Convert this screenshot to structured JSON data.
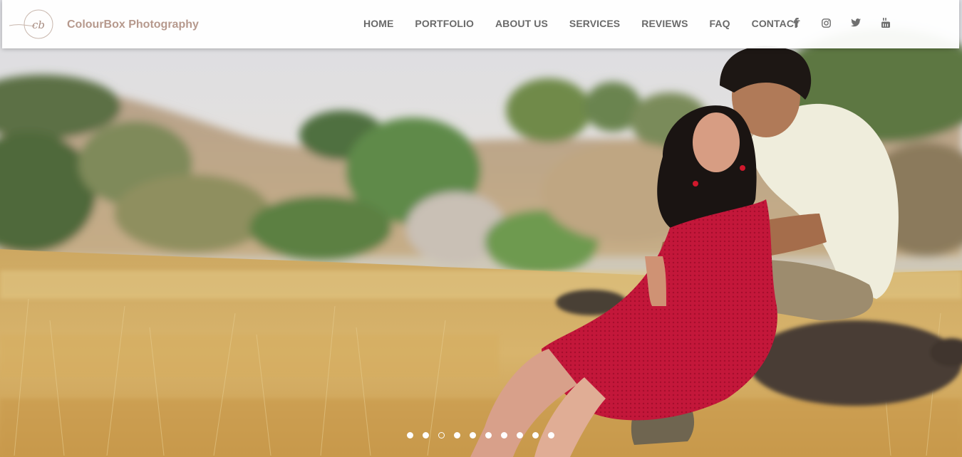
{
  "brand": {
    "name": "ColourBox Photography",
    "logo_icon": "cb-monogram-logo",
    "color": "#b6998d"
  },
  "nav": {
    "items": [
      {
        "label": "HOME"
      },
      {
        "label": "PORTFOLIO"
      },
      {
        "label": "ABOUT US"
      },
      {
        "label": "SERVICES"
      },
      {
        "label": "REVIEWS"
      },
      {
        "label": "FAQ"
      },
      {
        "label": "CONTACT"
      }
    ],
    "text_color": "#6a6a6a"
  },
  "socials": [
    {
      "icon": "facebook-icon"
    },
    {
      "icon": "instagram-icon"
    },
    {
      "icon": "twitter-icon"
    },
    {
      "icon": "youtube-icon"
    }
  ],
  "hero": {
    "image": "couple-sitting-in-golden-grass-field",
    "slider": {
      "total_slides": 10,
      "active_slide": 3
    }
  }
}
